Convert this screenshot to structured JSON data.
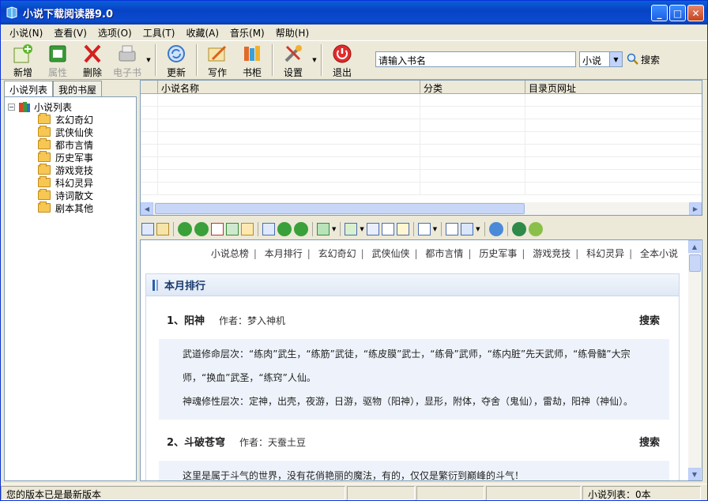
{
  "window": {
    "title": "小说下载阅读器9.0"
  },
  "menu": [
    "小说(N)",
    "查看(V)",
    "选项(O)",
    "工具(T)",
    "收藏(A)",
    "音乐(M)",
    "帮助(H)"
  ],
  "toolbar": {
    "new": "新增",
    "props": "属性",
    "delete": "删除",
    "ebook": "电子书",
    "update": "更新",
    "write": "写作",
    "shelf": "书柜",
    "settings": "设置",
    "exit": "退出"
  },
  "search": {
    "value": "请输入书名",
    "type_selected": "小说",
    "button": "搜索"
  },
  "left_tabs": {
    "list": "小说列表",
    "shelf": "我的书屋"
  },
  "tree": {
    "root": "小说列表",
    "items": [
      "玄幻奇幻",
      "武侠仙侠",
      "都市言情",
      "历史军事",
      "游戏竞技",
      "科幻灵异",
      "诗词散文",
      "剧本其他"
    ]
  },
  "list_columns": [
    "小说名称",
    "分类",
    "目录页网址"
  ],
  "page": {
    "nav": [
      "小说总榜",
      "本月排行",
      "玄幻奇幻",
      "武侠仙侠",
      "都市言情",
      "历史军事",
      "游戏竞技",
      "科幻灵异",
      "全本小说"
    ],
    "section_title": "本月排行",
    "search_label": "搜索",
    "entries": [
      {
        "title": "1、阳神",
        "author": "作者：梦入神机",
        "desc1": "武道修命层次：“练肉”武生，“练筋”武徒，“练皮膜”武士，“练骨”武师，“练内脏”先天武师，“练骨髓”大宗师，“换血”武圣，“练窍”人仙。",
        "desc2": "神魂修性层次：定神，出壳，夜游，日游，驱物（阳神），显形，附体，夺舍（鬼仙），雷劫，阳神（神仙）。"
      },
      {
        "title": "2、斗破苍穹",
        "author": "作者：天蚕土豆",
        "desc1": "这里是属于斗气的世界，没有花俏艳丽的魔法，有的，仅仅是繁衍到巅峰的斗气！"
      }
    ]
  },
  "status": {
    "message": "您的版本已是最新版本",
    "count": "小说列表：0本"
  },
  "colors": {
    "titlebar": "#0842c4",
    "accent": "#2b5fab"
  }
}
